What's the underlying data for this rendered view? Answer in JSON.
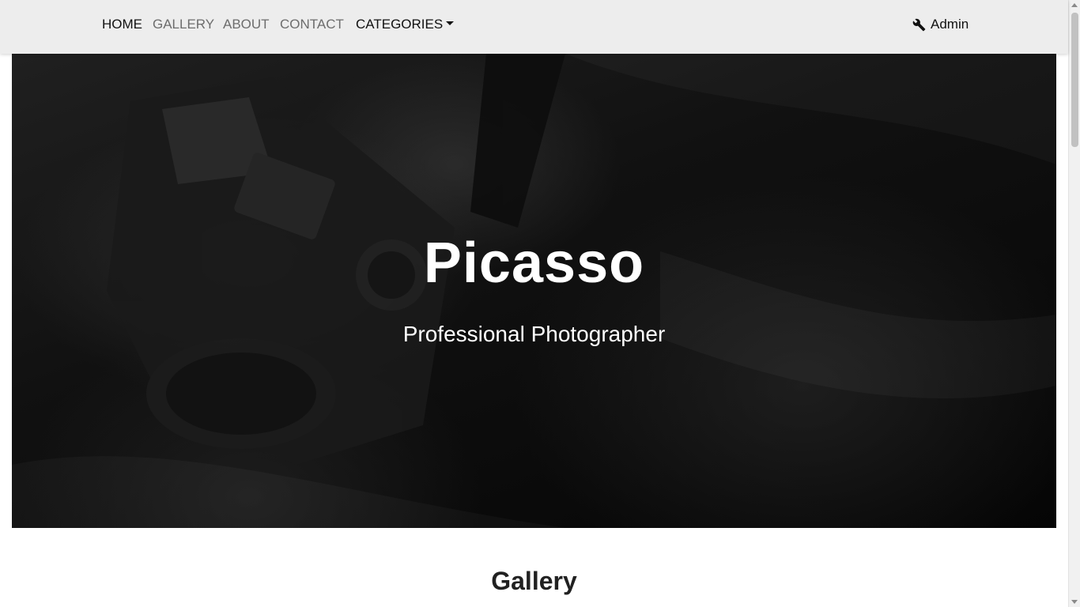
{
  "navbar": {
    "links": [
      {
        "label": "HOME",
        "active": true
      },
      {
        "label": "GALLERY",
        "active": false
      },
      {
        "label": "ABOUT",
        "active": false
      },
      {
        "label": "CONTACT",
        "active": false
      }
    ],
    "categories_label": "CATEGORIES",
    "admin_label": "Admin",
    "admin_icon": "wrench-icon"
  },
  "hero": {
    "title": "Picasso",
    "subtitle": "Professional Photographer",
    "background": "dark black-and-white photo of a camera"
  },
  "gallery": {
    "heading": "Gallery"
  },
  "colors": {
    "navbar_bg": "#ededed",
    "nav_active": "#111111",
    "nav_inactive": "#6d6d6d",
    "hero_text": "#ffffff"
  }
}
